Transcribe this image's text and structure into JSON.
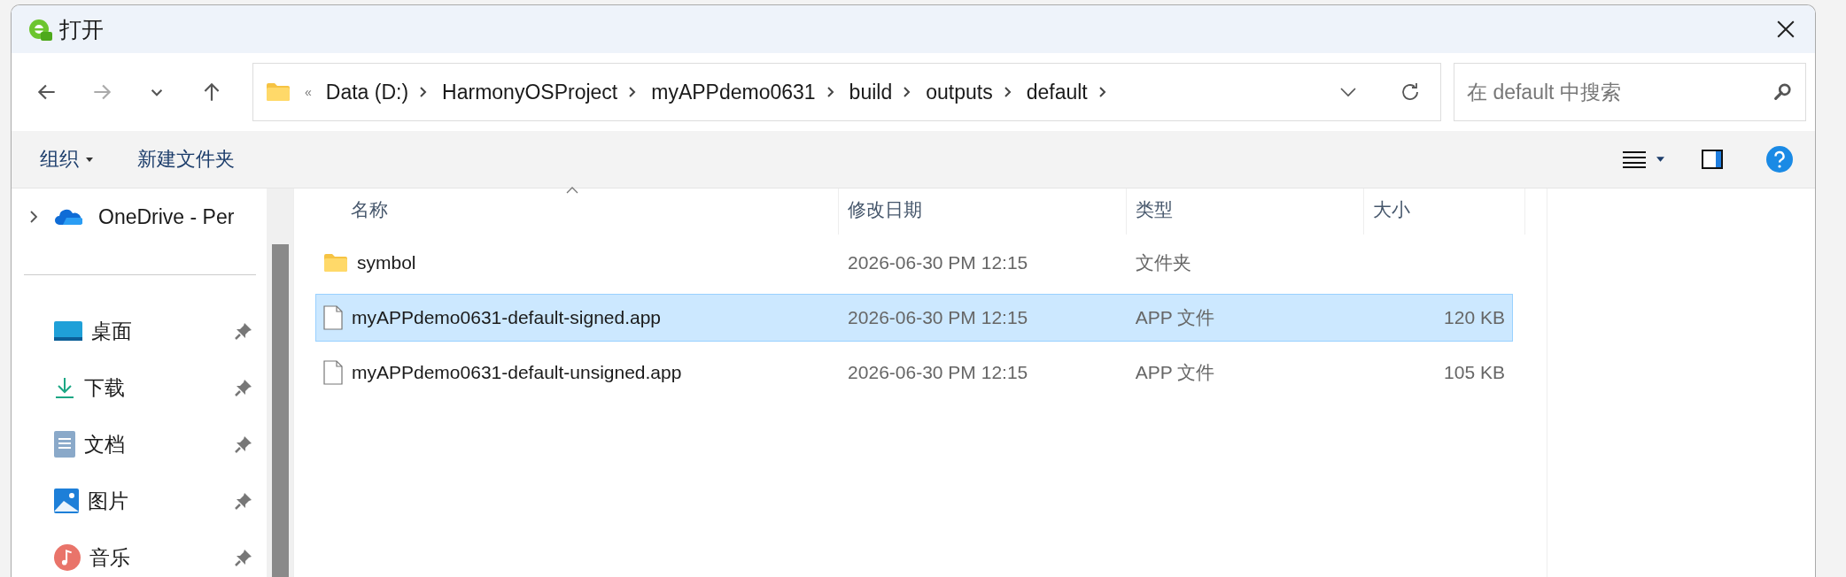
{
  "window": {
    "title": "打开"
  },
  "navigation": [
    {
      "kind": "back",
      "disabled": false
    },
    {
      "kind": "forward",
      "disabled": true
    },
    {
      "kind": "recent",
      "disabled": false
    },
    {
      "kind": "up",
      "disabled": false
    }
  ],
  "address_bar": {
    "overflow": "«",
    "segments": [
      "Data (D:)",
      "HarmonyOSProject",
      "myAPPdemo0631",
      "build",
      "outputs",
      "default"
    ]
  },
  "search": {
    "placeholder": "在 default 中搜索"
  },
  "toolbar": {
    "organize": "组织",
    "new_folder": "新建文件夹"
  },
  "sidebar": {
    "items": [
      {
        "label": "OneDrive - Per",
        "kind": "cloud",
        "pinned": false
      },
      {
        "label": "桌面",
        "kind": "desktop",
        "pinned": true
      },
      {
        "label": "下载",
        "kind": "download",
        "pinned": true
      },
      {
        "label": "文档",
        "kind": "documents",
        "pinned": true
      },
      {
        "label": "图片",
        "kind": "pictures",
        "pinned": true
      },
      {
        "label": "音乐",
        "kind": "music",
        "pinned": true
      }
    ]
  },
  "table": {
    "columns": [
      {
        "label": "名称",
        "sorted": true
      },
      {
        "label": "修改日期",
        "sorted": false
      },
      {
        "label": "类型",
        "sorted": false
      },
      {
        "label": "大小",
        "sorted": false
      }
    ],
    "rows": [
      {
        "kind": "folder",
        "name": "symbol",
        "modified": "2026-06-30 PM 12:15",
        "type": "文件夹",
        "size": null,
        "selected": false
      },
      {
        "kind": "file",
        "name": "myAPPdemo0631-default-signed.app",
        "modified": "2026-06-30 PM 12:15",
        "type": "APP 文件",
        "size": "120 KB",
        "selected": true
      },
      {
        "kind": "file",
        "name": "myAPPdemo0631-default-unsigned.app",
        "modified": "2026-06-30 PM 12:15",
        "type": "APP 文件",
        "size": "105 KB",
        "selected": false
      }
    ]
  }
}
